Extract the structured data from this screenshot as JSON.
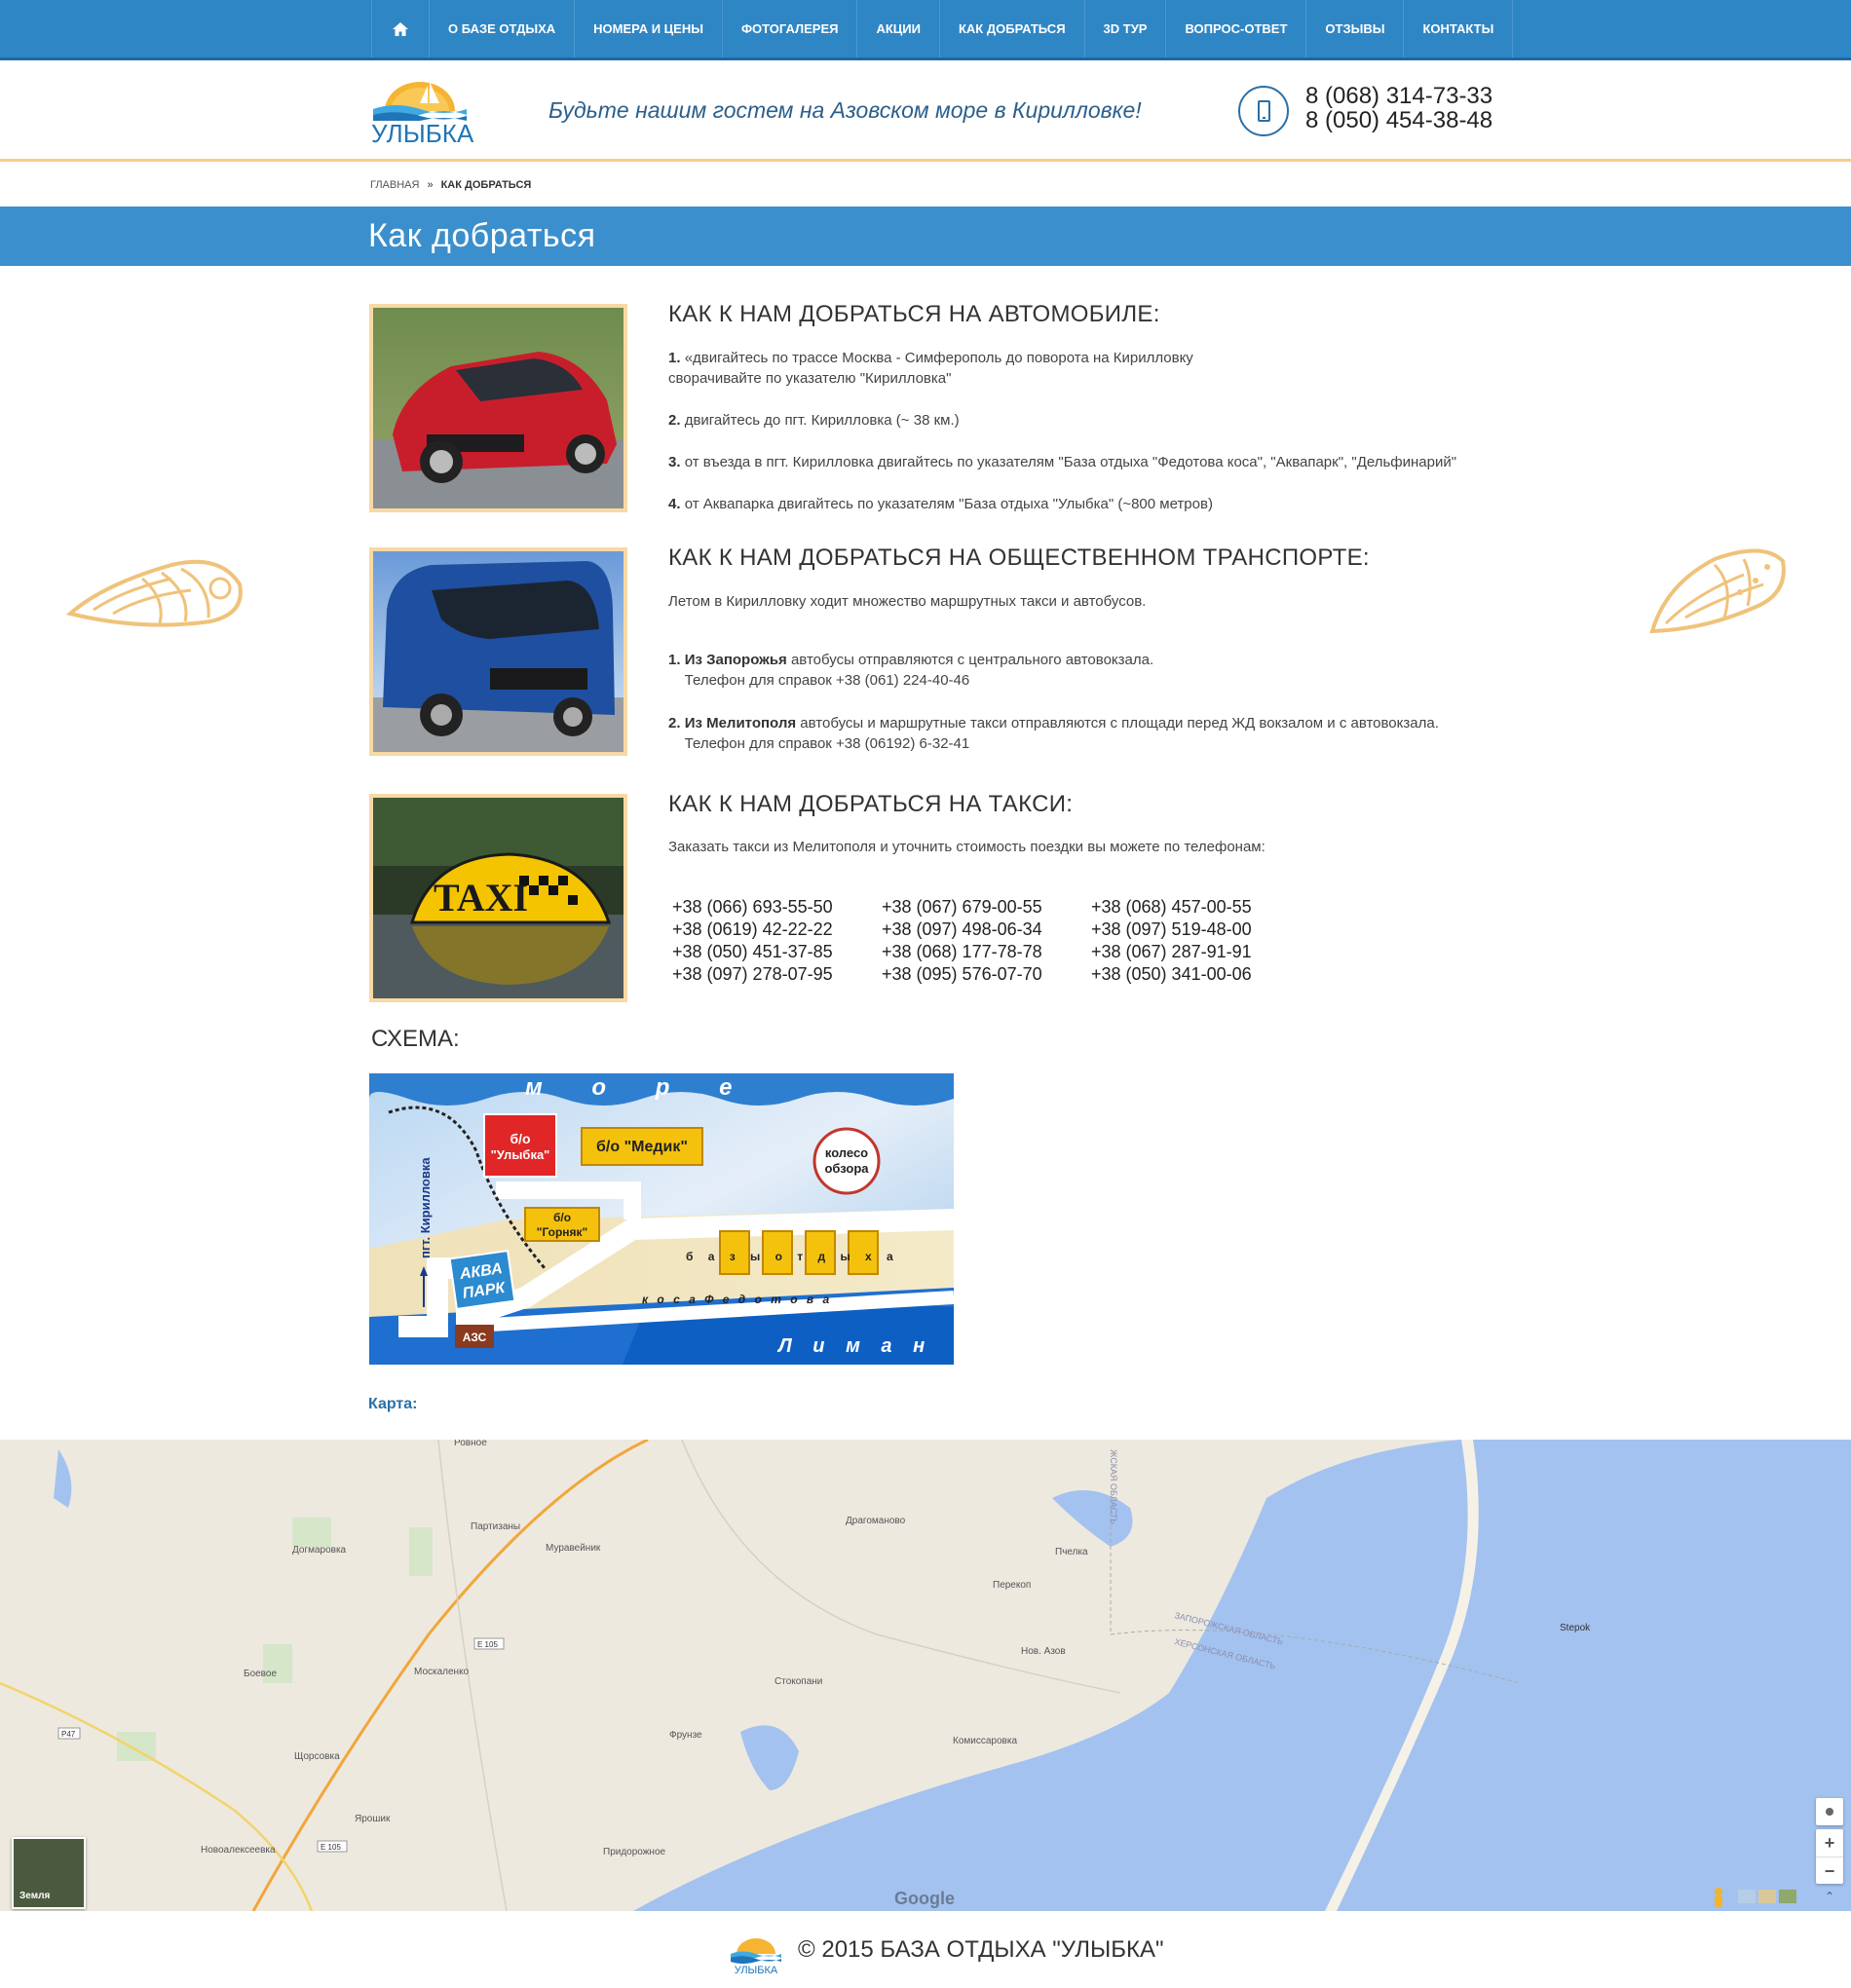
{
  "nav": {
    "home_icon": "home-icon",
    "items": [
      "О БАЗЕ ОТДЫХА",
      "НОМЕРА И ЦЕНЫ",
      "ФОТОГАЛЕРЕЯ",
      "АКЦИИ",
      "КАК ДОБРАТЬСЯ",
      "3D ТУР",
      "ВОПРОС-ОТВЕТ",
      "ОТЗЫВЫ",
      "КОНТАКТЫ"
    ]
  },
  "header": {
    "logo_text": "УЛЫБКА",
    "tagline": "Будьте нашим гостем на Азовском море в Кирилловке!",
    "phone1": "8 (068) 314-73-33",
    "phone2": "8 (050) 454-38-48"
  },
  "breadcrumb": {
    "home": "ГЛАВНАЯ",
    "sep": "»",
    "current": "КАК ДОБРАТЬСЯ"
  },
  "page_title": "Как  добраться",
  "car": {
    "title": "КАК К НАМ ДОБРАТЬСЯ НА АВТОМОБИЛЕ:",
    "s1_num": "1.",
    "s1_text": "«двигайтесь по трассе Москва - Симферополь до поворота на Кирилловку",
    "s1_text2": "сворачивайте по указателю \"Кирилловка\"",
    "s2_num": "2.",
    "s2_text": "двигайтесь до пгт. Кирилловка (~ 38 км.)",
    "s3_num": "3.",
    "s3_text": "от въезда в пгт. Кирилловка двигайтесь по указателям \"База отдыха \"Федотова коса\", \"Аквапарк\", \"Дельфинарий\"",
    "s4_num": "4.",
    "s4_text": "от Аквапарка двигайтесь по указателям \"База отдыха \"Улыбка\" (~800 метров)"
  },
  "bus": {
    "title": "КАК К НАМ ДОБРАТЬСЯ НА ОБЩЕСТВЕННОМ ТРАНСПОРТЕ:",
    "intro": "Летом в Кирилловку ходит множество маршрутных такси и автобусов.",
    "s1_num": "1.",
    "s1_bold": "Из Запорожья",
    "s1_text": "автобусы отправляются с центрального автовокзала.",
    "s1_phone": "Телефон для справок +38 (061) 224-40-46",
    "s2_num": "2.",
    "s2_bold": "Из Мелитополя",
    "s2_text": "автобусы и маршрутные такси отправляются с площади перед ЖД вокзалом и с автовокзала.",
    "s2_phone": "Телефон для справок +38 (06192) 6-32-41"
  },
  "taxi": {
    "title": "КАК К НАМ ДОБРАТЬСЯ НА ТАКСИ:",
    "intro": "Заказать такси из Мелитополя и уточнить стоимость поездки вы можете по телефонам:",
    "sign": "TAXI",
    "phones": [
      "+38 (066) 693-55-50",
      "+38 (067) 679-00-55",
      "+38 (068) 457-00-55",
      "+38 (0619) 42-22-22",
      "+38 (097) 498-06-34",
      "+38 (097) 519-48-00",
      "+38 (050) 451-37-85",
      "+38 (068) 177-78-78",
      "+38 (067) 287-91-91",
      "+38 (097) 278-07-95",
      "+38 (095) 576-07-70",
      "+38 (050) 341-00-06"
    ]
  },
  "schema": {
    "title": "СХЕМА:",
    "sea": "м о р е",
    "ulybka": "б/о\n\"Улыбка\"",
    "ulybka_l1": "б/о",
    "ulybka_l2": "\"Улыбка\"",
    "medik": "б/о \"Медик\"",
    "wheel_l1": "колесо",
    "wheel_l2": "обзора",
    "gornyak_l1": "б/о",
    "gornyak_l2": "\"Горняк\"",
    "town": "пгт. Кирилловка",
    "aqua_l1": "АКВА",
    "aqua_l2": "ПАРК",
    "bases": "б а з ы   о т д ы х а",
    "spit": "к о с а   Ф е д о т о в а",
    "azs": "АЗС",
    "liman": "Л и м а н"
  },
  "map": {
    "label": "Карта:",
    "places": [
      "Ровное",
      "Партизаны",
      "Догмаровка",
      "Муравейник",
      "Драгоманово",
      "Пчелка",
      "Перекоп",
      "Боевое",
      "Москаленко",
      "Нов. Азов",
      "Стокопани",
      "Фрунзе",
      "Комиссаровка",
      "Щорсовка",
      "Ярошик",
      "Новоалексеевка",
      "Придорожное",
      "Stepok"
    ],
    "roads": [
      "E 105",
      "P47",
      "E 105"
    ],
    "regions": [
      "ЗАПОРОЖСКАЯ ОБЛАСТЬ",
      "ХЕРСОНСКАЯ ОБЛАСТЬ",
      "ЖСКАЯ ОБЛАСТЬ"
    ],
    "earth": "Земля",
    "google": "Google",
    "zoom_in": "+",
    "zoom_out": "−"
  },
  "footer": {
    "text": "© 2015 БАЗА ОТДЫХА \"УЛЫБКА\"",
    "logo_text": "УЛЫБКА"
  },
  "colors": {
    "nav": "#2f86c5",
    "title_band": "#3b8fcc",
    "accent_border": "#f7cd88",
    "photo_border": "#f7d9a4",
    "shell": "#f0c27a",
    "sea_map": "#a3c2ef"
  }
}
